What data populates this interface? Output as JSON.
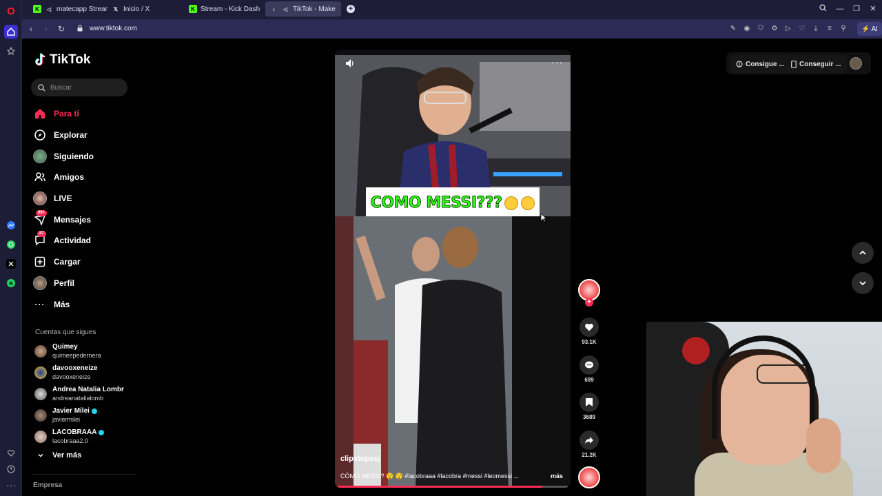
{
  "browser": {
    "tabs": [
      {
        "label": "matecapp Stream - W",
        "favicon": "kick-icon",
        "color": "#53fc18"
      },
      {
        "label": "Inicio / X",
        "favicon": "x-icon",
        "color": "#ffffff"
      },
      {
        "label": "Stream - Kick Dashboard",
        "favicon": "kick-icon",
        "color": "#53fc18"
      },
      {
        "label": "TikTok - Make Your Da",
        "favicon": "tiktok-icon",
        "color": "#ffffff",
        "active": true
      }
    ],
    "url": "www.tiktok.com",
    "ai_label": "AI"
  },
  "tiktok": {
    "brand": "TikTok",
    "search_placeholder": "Buscar",
    "nav": [
      {
        "label": "Para ti",
        "icon": "home-icon",
        "active": true
      },
      {
        "label": "Explorar",
        "icon": "compass-icon"
      },
      {
        "label": "Siguiendo",
        "icon": "following-avatar"
      },
      {
        "label": "Amigos",
        "icon": "friends-icon"
      },
      {
        "label": "LIVE",
        "icon": "live-avatar"
      },
      {
        "label": "Mensajes",
        "icon": "messages-icon",
        "badge": "99+"
      },
      {
        "label": "Actividad",
        "icon": "activity-icon",
        "badge": "87"
      },
      {
        "label": "Cargar",
        "icon": "upload-icon"
      },
      {
        "label": "Perfil",
        "icon": "profile-avatar"
      },
      {
        "label": "Más",
        "icon": "more-icon"
      }
    ],
    "following_title": "Cuentas que sigues",
    "following": [
      {
        "name": "Quimey",
        "handle": "quimeepedernera",
        "verified": false
      },
      {
        "name": "davooxeneize",
        "handle": "davooxeneize",
        "verified": false
      },
      {
        "name": "Andrea Natalia Lombr",
        "handle": "andreanatalialomb",
        "verified": false
      },
      {
        "name": "Javier Milei",
        "handle": "javiermilei",
        "verified": true
      },
      {
        "name": "LACOBRAAA",
        "handle": "lacobraaa2.0",
        "verified": true
      }
    ],
    "see_more": "Ver más",
    "footer": "Empresa",
    "top_actions": {
      "coins": "Consigue ...",
      "app": "Conseguir ..."
    }
  },
  "video": {
    "overlay_text": "COMO MESSI???",
    "username": "clipstopssj",
    "description": "CÓMO MESSI? 😲 😲 #lacobraaa #lacobra #messi #leomessi ...",
    "more": "más",
    "likes": "93.1K",
    "comments": "699",
    "saves": "3689",
    "shares": "21.2K",
    "progress": 0.89
  },
  "colors": {
    "accent": "#fe2c55",
    "sidebar": "#1d1d37",
    "addressbar": "#2b2b55"
  }
}
